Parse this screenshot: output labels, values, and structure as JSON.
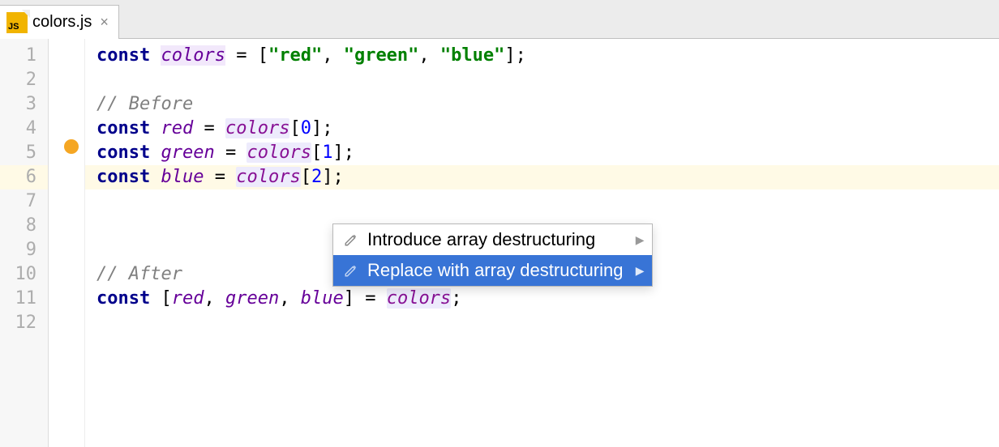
{
  "tab": {
    "filename": "colors.js",
    "icon_label": "JS"
  },
  "gutter": {
    "lines": [
      "1",
      "2",
      "3",
      "4",
      "5",
      "6",
      "7",
      "8",
      "9",
      "10",
      "11",
      "12"
    ],
    "current": 6
  },
  "code": {
    "l1": {
      "const": "const",
      "name": "colors",
      "eq": " = ",
      "lb": "[",
      "s1": "\"red\"",
      "c1": ", ",
      "s2": "\"green\"",
      "c2": ", ",
      "s3": "\"blue\"",
      "rb": "]",
      "end": ";"
    },
    "l3": {
      "comment": "// Before"
    },
    "l4": {
      "const": "const",
      "name": "red",
      "eq": " = ",
      "ref": "colors",
      "lb": "[",
      "idx": "0",
      "rb": "]",
      "end": ";"
    },
    "l5": {
      "const": "const",
      "name": "green",
      "eq": " = ",
      "ref": "colors",
      "lb": "[",
      "idx": "1",
      "rb": "]",
      "end": ";"
    },
    "l6": {
      "const": "const",
      "name": "blue",
      "eq": " = ",
      "ref": "colors",
      "lb": "[",
      "idx": "2",
      "rb": "]",
      "end": ";"
    },
    "l10": {
      "comment": "// After"
    },
    "l11": {
      "const": "const",
      "lb": " [",
      "v1": "red",
      "c1": ", ",
      "v2": "green",
      "c2": ", ",
      "v3": "blue",
      "rb": "]",
      "eq": " = ",
      "ref": "colors",
      "end": ";"
    }
  },
  "popup": {
    "items": [
      {
        "label": "Introduce array destructuring",
        "selected": false
      },
      {
        "label": "Replace with array destructuring",
        "selected": true
      }
    ]
  }
}
